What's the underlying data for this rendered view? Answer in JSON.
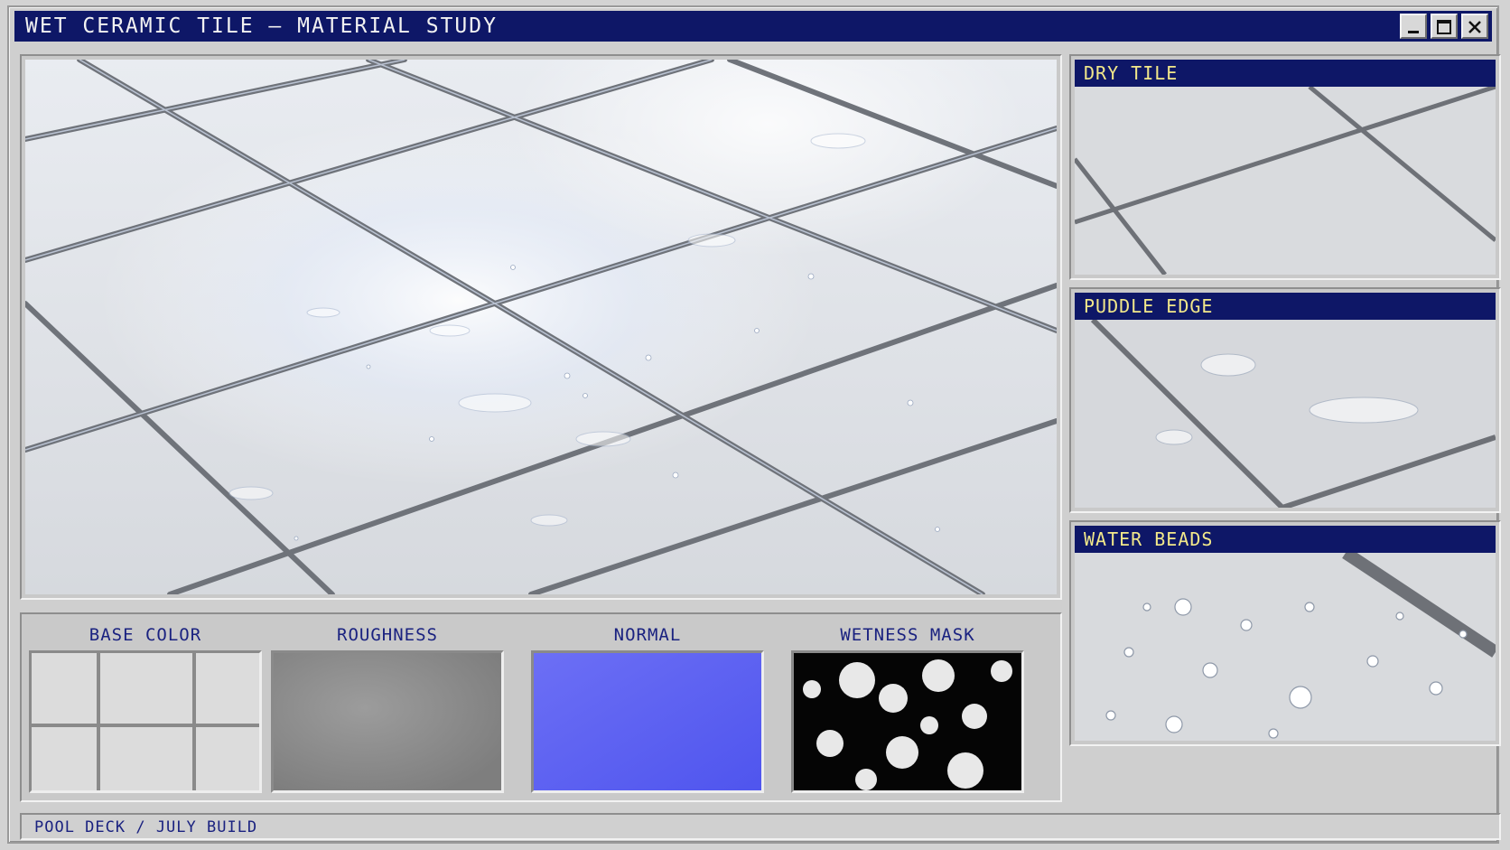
{
  "window": {
    "title": "WET CERAMIC TILE — MATERIAL STUDY",
    "controls": [
      "minimize",
      "maximize",
      "close"
    ]
  },
  "maps": [
    {
      "label": "BASE COLOR"
    },
    {
      "label": "ROUGHNESS"
    },
    {
      "label": "NORMAL"
    },
    {
      "label": "WETNESS MASK"
    }
  ],
  "details": [
    {
      "label": "DRY TILE"
    },
    {
      "label": "PUDDLE EDGE"
    },
    {
      "label": "WATER BEADS"
    }
  ],
  "status": {
    "text": "POOL DECK / JULY BUILD"
  },
  "colors": {
    "titlebar": "#0e1767",
    "panel_label_text": "#f2e88a",
    "map_label_text": "#1a2280",
    "normal_map": "#5b63f2"
  }
}
